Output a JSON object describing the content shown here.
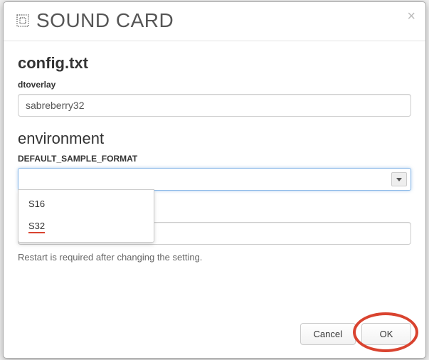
{
  "modal": {
    "title": "SOUND CARD",
    "close_label": "×"
  },
  "config": {
    "section_title": "config.txt",
    "dtoverlay_label": "dtoverlay",
    "dtoverlay_value": "sabreberry32"
  },
  "environment": {
    "section_title": "environment",
    "label": "DEFAULT_SAMPLE_FORMAT",
    "selected_value": "",
    "options": [
      "S16",
      "S32"
    ]
  },
  "hint": "Restart is required after changing the setting.",
  "footer": {
    "cancel": "Cancel",
    "ok": "OK"
  }
}
